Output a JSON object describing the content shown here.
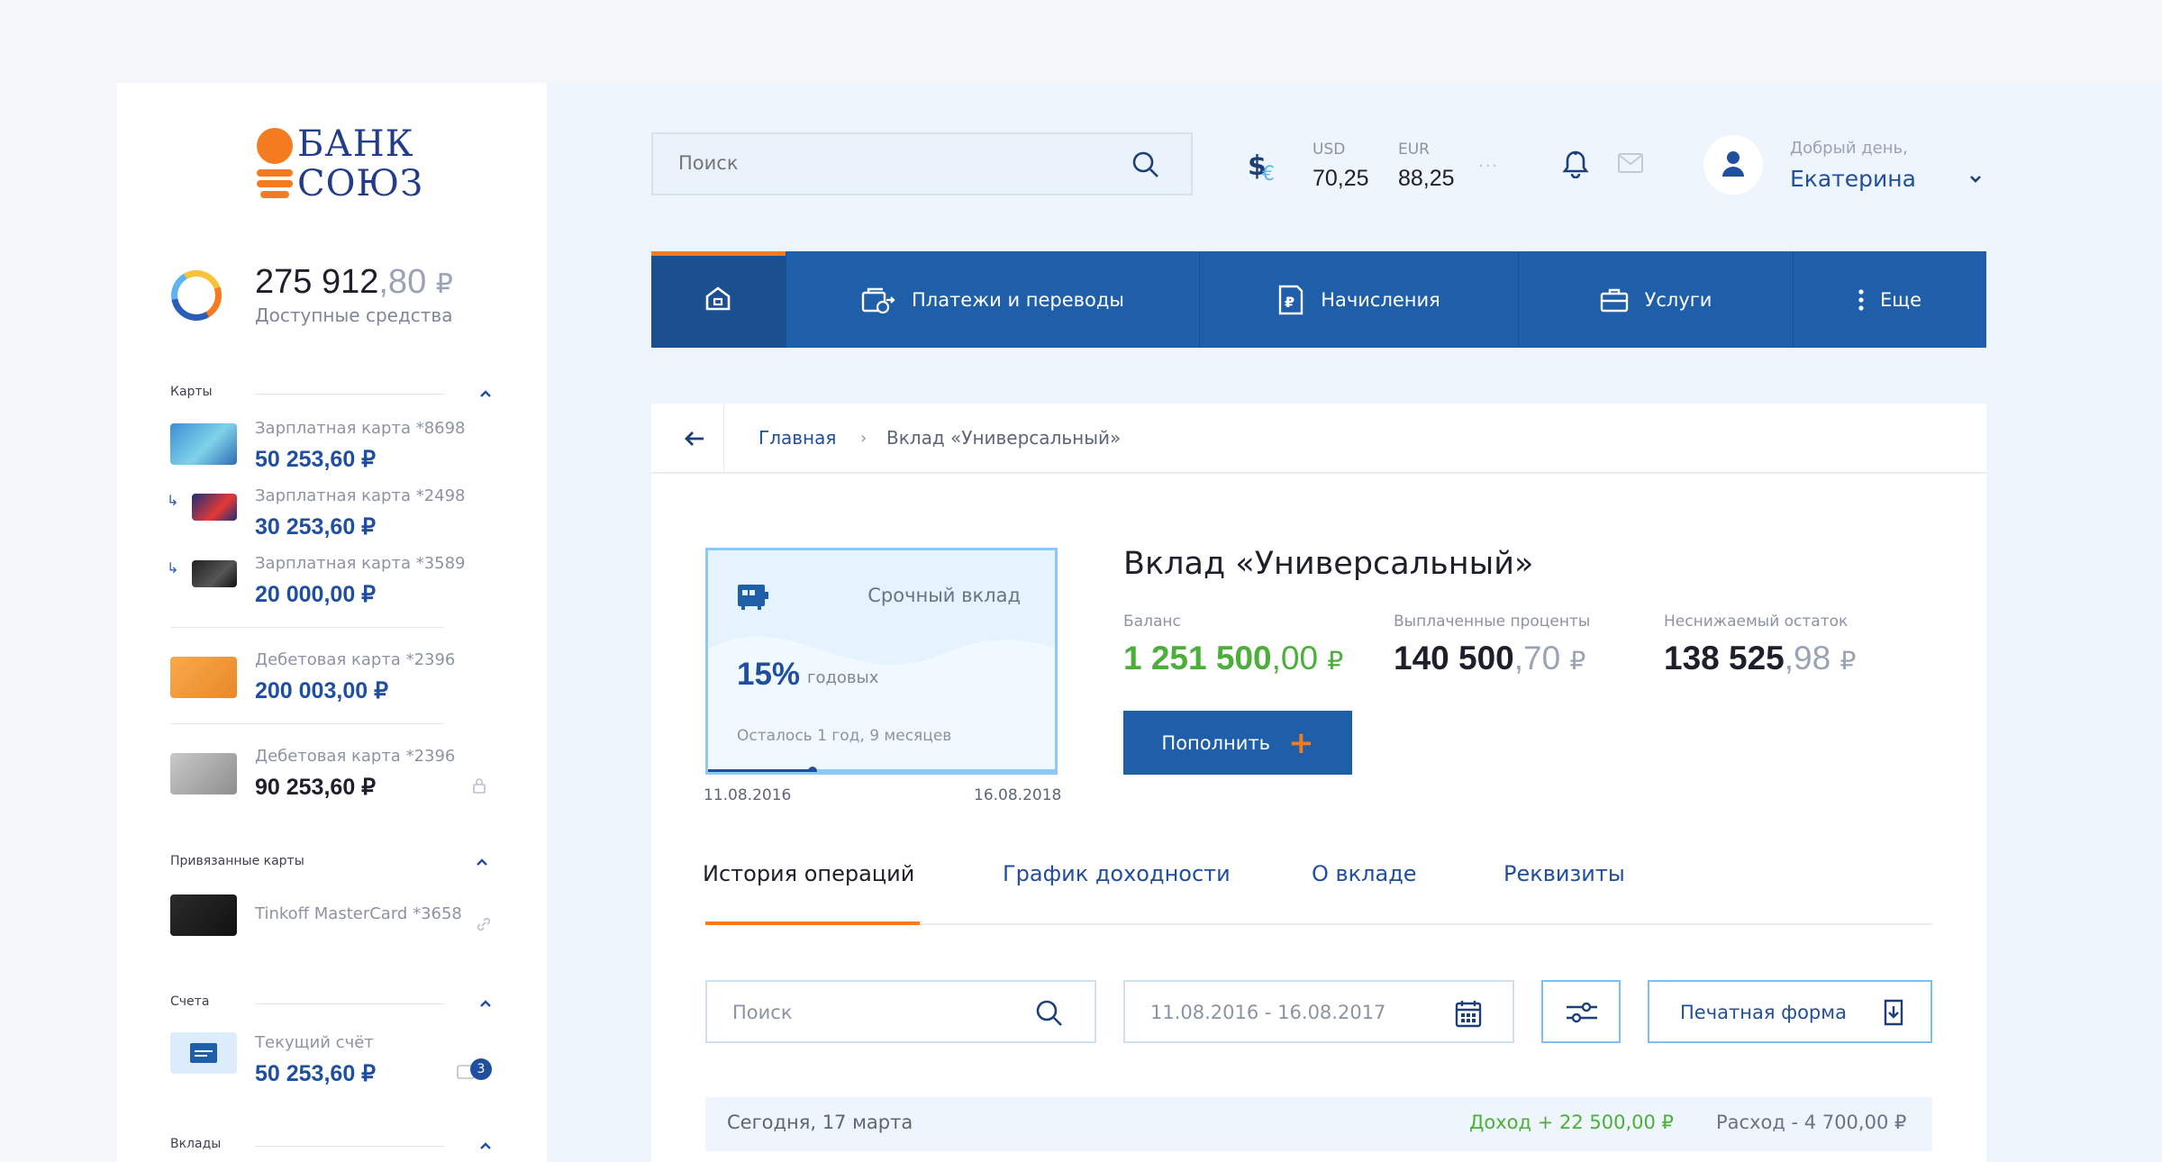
{
  "brand": {
    "logo_line1": "БАНК",
    "logo_line2": "СОЮЗ",
    "color": "#f47b20"
  },
  "balance": {
    "integer": "275 912",
    "decimal": ",80",
    "currency": "₽",
    "label": "Доступные средства"
  },
  "sidebar": {
    "cards_title": "Карты",
    "cards": [
      {
        "name": "Зарплатная карта *8698",
        "amount": "50 253,60 ₽"
      },
      {
        "name": "Зарплатная карта *2498",
        "amount": "30 253,60 ₽"
      },
      {
        "name": "Зарплатная карта *3589",
        "amount": "20 000,00 ₽"
      },
      {
        "name": "Дебетовая карта *2396",
        "amount": "200 003,00 ₽"
      },
      {
        "name": "Дебетовая карта *2396",
        "amount": "90 253,60 ₽"
      }
    ],
    "linked_title": "Привязанные карты",
    "linked": [
      {
        "name": "Tinkoff MasterCard *3658"
      }
    ],
    "accounts_title": "Счета",
    "accounts": [
      {
        "name": "Текущий счёт",
        "amount": "50 253,60 ₽",
        "badge": "3"
      }
    ],
    "deposits_title": "Вклады"
  },
  "topbar": {
    "search_placeholder": "Поиск",
    "usd_label": "USD",
    "usd_value": "70,25",
    "eur_label": "EUR",
    "eur_value": "88,25",
    "more": "···",
    "greeting": "Добрый день,",
    "user_name": "Екатерина"
  },
  "nav": {
    "items": [
      {
        "label": "Платежи и переводы",
        "icon": "payments-icon"
      },
      {
        "label": "Начисления",
        "icon": "charges-icon"
      },
      {
        "label": "Услуги",
        "icon": "briefcase-icon"
      },
      {
        "label": "Еще",
        "icon": "more-vertical-icon"
      }
    ]
  },
  "breadcrumb": {
    "home": "Главная",
    "separator": "›",
    "current": "Вклад «Универсальный»"
  },
  "deposit": {
    "type": "Срочный вклад",
    "rate": "15%",
    "rate_label": "годовых",
    "remaining": "Осталось 1 год, 9 месяцев",
    "start_date": "11.08.2016",
    "end_date": "16.08.2018",
    "progress": 0.3,
    "title": "Вклад «Универсальный»",
    "stats": [
      {
        "label": "Баланс",
        "integer": "1 251 500",
        "decimal": ",00",
        "currency": "₽"
      },
      {
        "label": "Выплаченные проценты",
        "integer": "140 500",
        "decimal": ",70",
        "currency": "₽"
      },
      {
        "label": "Неснижаемый остаток",
        "integer": "138 525",
        "decimal": ",98",
        "currency": "₽"
      }
    ],
    "topup_label": "Пополнить",
    "topup_plus": "+"
  },
  "tabs": [
    {
      "label": "История операций",
      "active": true
    },
    {
      "label": "График доходности",
      "active": false
    },
    {
      "label": "О вкладе",
      "active": false
    },
    {
      "label": "Реквизиты",
      "active": false
    }
  ],
  "filters": {
    "search_placeholder": "Поиск",
    "date_range": "11.08.2016 - 16.08.2017",
    "print_label": "Печатная форма"
  },
  "day_summary": {
    "date": "Сегодня, 17 марта",
    "income": "Доход + 22 500,00 ₽",
    "expense": "Расход - 4 700,00 ₽"
  },
  "colors": {
    "primary": "#1f5ea8",
    "accent": "#f47b20",
    "positive": "#4caf3a",
    "link": "#1f4f9e"
  }
}
